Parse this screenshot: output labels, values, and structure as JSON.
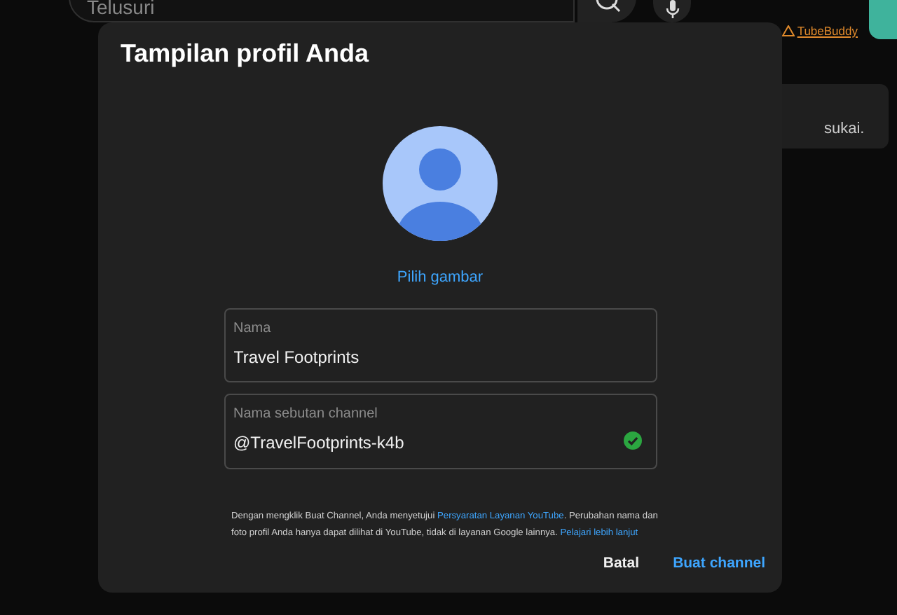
{
  "background": {
    "search": {
      "placeholder": "Telusuri"
    },
    "extension_link": "TubeBuddy",
    "card_text": "sukai."
  },
  "dialog": {
    "title": "Tampilan profil Anda",
    "choose_picture": "Pilih gambar",
    "fields": [
      {
        "label": "Nama",
        "value": "Travel Footprints",
        "valid": false
      },
      {
        "label": "Nama sebutan channel",
        "value": "@TravelFootprints-k4b",
        "valid": true
      }
    ],
    "terms": [
      {
        "kind": "text",
        "text": "Dengan mengklik Buat Channel, Anda menyetujui "
      },
      {
        "kind": "link",
        "text": "Persyaratan Layanan YouTube"
      },
      {
        "kind": "text",
        "text": ". Perubahan nama dan foto profil Anda hanya dapat dilihat di YouTube, tidak di layanan Google lainnya. "
      },
      {
        "kind": "link",
        "text": "Pelajari lebih lanjut"
      }
    ],
    "buttons": [
      {
        "label": "Batal",
        "kind": "secondary"
      },
      {
        "label": "Buat channel",
        "kind": "primary"
      }
    ]
  }
}
